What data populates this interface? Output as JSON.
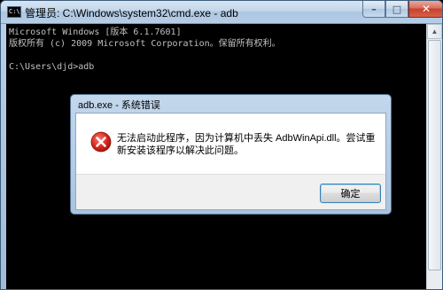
{
  "window": {
    "title": "管理员: C:\\Windows\\system32\\cmd.exe - adb",
    "icon": "cmd-icon",
    "minimize_glyph": "–",
    "maximize_glyph": "□",
    "close_glyph": "✕"
  },
  "console": {
    "lines": [
      "Microsoft Windows [版本 6.1.7601]",
      "版权所有 (c) 2009 Microsoft Corporation。保留所有权利。",
      "",
      "C:\\Users\\djd>adb"
    ]
  },
  "dialog": {
    "title": "adb.exe - 系统错误",
    "icon": "error-icon",
    "message": "无法启动此程序，因为计算机中丢失 AdbWinApi.dll。尝试重新安装该程序以解决此问题。",
    "ok_label": "确定"
  },
  "colors": {
    "console_bg": "#000000",
    "console_text": "#c0c0c0",
    "error_red": "#d9261c",
    "close_button": "#c8412a"
  }
}
